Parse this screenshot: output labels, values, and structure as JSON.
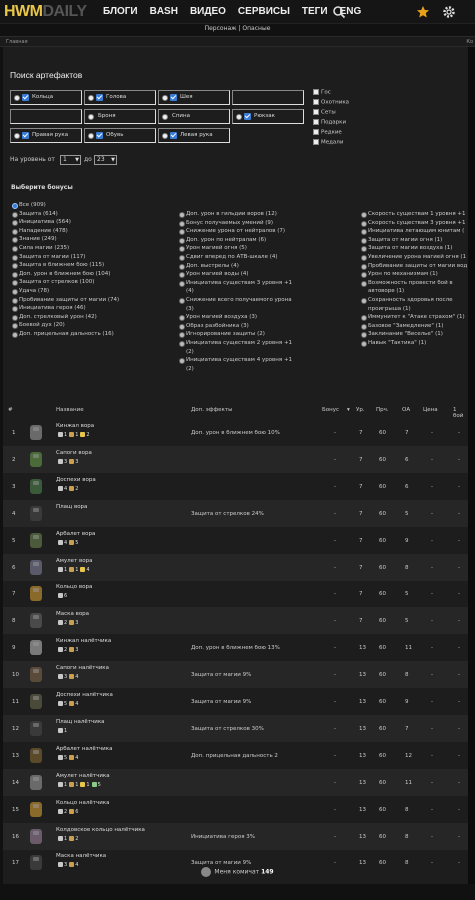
{
  "header": {
    "logo_main": "HWM",
    "logo_sub": "DAILY",
    "nav": [
      "БЛОГИ",
      "BASH",
      "ВИДЕО",
      "СЕРВИСЫ",
      "ТЕГИ",
      "ENG"
    ],
    "subtitle": "Персонаж | Опасные"
  },
  "breadcrumb": {
    "left": "Главная",
    "right": "Ко"
  },
  "search": {
    "title": "Поиск артефактов",
    "slots": [
      {
        "label": "Кольца",
        "checked": true
      },
      {
        "label": "Голова",
        "checked": true
      },
      {
        "label": "Шея",
        "checked": true
      },
      {
        "label": "",
        "checked": false
      },
      {
        "label": "",
        "checked": false
      },
      {
        "label": "Броня",
        "checked": false
      },
      {
        "label": "Спина",
        "checked": false
      },
      {
        "label": "Рюкзак",
        "checked": true
      },
      {
        "label": "Правая рука",
        "checked": true
      },
      {
        "label": "Обувь",
        "checked": true
      },
      {
        "label": "Левая рука",
        "checked": true
      }
    ],
    "checkboxes": [
      "Гос",
      "Охотника",
      "Сеты",
      "Подарки",
      "Редкие",
      "Медали"
    ],
    "level_label_from": "На уровень от",
    "level_from": "1",
    "level_label_to": "до",
    "level_to": "23"
  },
  "bonuses": {
    "title": "Выберите бонусы",
    "col1": [
      "Все (909)",
      "Защита (614)",
      "Инициатива (564)",
      "Нападение (478)",
      "Знание (249)",
      "Сила магии (235)",
      "Защита от магии (117)",
      "Защита в ближнем бою (115)",
      "Доп. урон в ближнем бою (104)",
      "Защита от стрелков (100)",
      "Удача (78)",
      "Пробивание защиты от магии (74)",
      "Инициатива героя (46)",
      "Доп. стрелковый урон (42)",
      "Боевой дух (20)",
      "Доп. прицельная дальность (16)"
    ],
    "col2": [
      "Доп. урон в гильдии воров (12)",
      "Бонус получаемых умений (9)",
      "Снижение урона от нейтралов (7)",
      "Доп. урон по нейтралам (6)",
      "Урон магией огня (5)",
      "Сдвиг вперед по АТВ-шкале (4)",
      "Доп. выстрелы (4)",
      "Урон магией воды (4)",
      "Инициатива существам 3 уровня +1 (4)",
      "Снижение всего получаемого урона (3)",
      "Урон магией воздуха (3)",
      "Образ разбойника (3)",
      "Игнорирование защиты (2)",
      "Инициатива существам 2 уровня +1 (2)",
      "Инициатива существам 4 уровня +1 (2)"
    ],
    "col3": [
      "Скорость существам 1 уровня +1",
      "Скорость существам 3 уровня +1",
      "Инициатива летающим юнитам (",
      "Защита от магии огня (1)",
      "Защита от магии воздуха (1)",
      "Увеличение урона магией огня (1",
      "Пробивание защиты от магии вод",
      "Урон по механизмам (1)",
      "Возможность провести бой в автоворе (1)",
      "Сохранность здоровья после проигрыша (1)",
      "Иммунитет к \"Атаке страхом\" (1)",
      "Базовое \"Замедление\" (1)",
      "Заклинание \"Веселье\" (1)",
      "Навык \"Тактика\" (1)"
    ]
  },
  "table": {
    "headers": [
      "#",
      "Название",
      "Доп. эффекты",
      "Бонус",
      "Ур.",
      "Прч.",
      "ОА",
      "Цена",
      "1 бой"
    ],
    "rows": [
      {
        "n": "1",
        "name": "Кинжал вора",
        "stats": [
          "1",
          "1",
          "2"
        ],
        "eff": "Доп. урон в ближнем бою 10%",
        "bonus": "-",
        "lvl": "7",
        "dur": "60",
        "oa": "7",
        "price": "-",
        "fight": "-"
      },
      {
        "n": "2",
        "name": "Сапоги вора",
        "stats": [
          "3",
          "3"
        ],
        "eff": "",
        "bonus": "-",
        "lvl": "7",
        "dur": "60",
        "oa": "6",
        "price": "-",
        "fight": "-"
      },
      {
        "n": "3",
        "name": "Доспехи вора",
        "stats": [
          "4",
          "2"
        ],
        "eff": "",
        "bonus": "-",
        "lvl": "7",
        "dur": "60",
        "oa": "6",
        "price": "-",
        "fight": "-"
      },
      {
        "n": "4",
        "name": "Плащ вора",
        "stats": [],
        "eff": "Защита от стрелков 24%",
        "bonus": "-",
        "lvl": "7",
        "dur": "60",
        "oa": "5",
        "price": "-",
        "fight": "-"
      },
      {
        "n": "5",
        "name": "Арбалет вора",
        "stats": [
          "4",
          "5"
        ],
        "eff": "",
        "bonus": "-",
        "lvl": "7",
        "dur": "60",
        "oa": "9",
        "price": "-",
        "fight": "-"
      },
      {
        "n": "6",
        "name": "Амулет вора",
        "stats": [
          "1",
          "1",
          "4"
        ],
        "eff": "",
        "bonus": "-",
        "lvl": "7",
        "dur": "60",
        "oa": "8",
        "price": "-",
        "fight": "-"
      },
      {
        "n": "7",
        "name": "Кольцо вора",
        "stats": [
          "6"
        ],
        "eff": "",
        "bonus": "-",
        "lvl": "7",
        "dur": "60",
        "oa": "5",
        "price": "-",
        "fight": "-"
      },
      {
        "n": "8",
        "name": "Маска вора",
        "stats": [
          "2",
          "3"
        ],
        "eff": "",
        "bonus": "-",
        "lvl": "7",
        "dur": "60",
        "oa": "5",
        "price": "-",
        "fight": "-"
      },
      {
        "n": "9",
        "name": "Кинжал налётчика",
        "stats": [
          "2",
          "3"
        ],
        "eff": "Доп. урон в ближнем бою 13%",
        "bonus": "-",
        "lvl": "13",
        "dur": "60",
        "oa": "11",
        "price": "-",
        "fight": "-"
      },
      {
        "n": "10",
        "name": "Сапоги налётчика",
        "stats": [
          "3",
          "4"
        ],
        "eff": "Защита от магии 9%",
        "bonus": "-",
        "lvl": "13",
        "dur": "60",
        "oa": "8",
        "price": "-",
        "fight": "-"
      },
      {
        "n": "11",
        "name": "Доспехи налётчика",
        "stats": [
          "5",
          "4"
        ],
        "eff": "Защита от магии 9%",
        "bonus": "-",
        "lvl": "13",
        "dur": "60",
        "oa": "9",
        "price": "-",
        "fight": "-"
      },
      {
        "n": "12",
        "name": "Плащ налётчика",
        "stats": [
          "1"
        ],
        "eff": "Защита от стрелков 30%",
        "bonus": "-",
        "lvl": "13",
        "dur": "60",
        "oa": "7",
        "price": "-",
        "fight": "-"
      },
      {
        "n": "13",
        "name": "Арбалет налётчика",
        "stats": [
          "5",
          "4"
        ],
        "eff": "Доп. прицельная дальность 2",
        "bonus": "-",
        "lvl": "13",
        "dur": "60",
        "oa": "12",
        "price": "-",
        "fight": "-"
      },
      {
        "n": "14",
        "name": "Амулет налётчика",
        "stats": [
          "1",
          "1",
          "1",
          "5"
        ],
        "eff": "",
        "bonus": "-",
        "lvl": "13",
        "dur": "60",
        "oa": "11",
        "price": "-",
        "fight": "-"
      },
      {
        "n": "15",
        "name": "Кольцо налётчика",
        "stats": [
          "2",
          "6"
        ],
        "eff": "",
        "bonus": "-",
        "lvl": "13",
        "dur": "60",
        "oa": "8",
        "price": "-",
        "fight": "-"
      },
      {
        "n": "16",
        "name": "Колдовское кольцо налётчика",
        "stats": [
          "1",
          "2"
        ],
        "eff": "Инициатива героя 3%",
        "bonus": "-",
        "lvl": "13",
        "dur": "60",
        "oa": "8",
        "price": "-",
        "fight": "-"
      },
      {
        "n": "17",
        "name": "Маска налётчика",
        "stats": [
          "3",
          "4"
        ],
        "eff": "Защита от магии 9%",
        "bonus": "-",
        "lvl": "13",
        "dur": "60",
        "oa": "8",
        "price": "-",
        "fight": "-"
      }
    ]
  },
  "footer": {
    "text": "Меня комичат",
    "count": "149"
  },
  "colors": {
    "accent": "#e8c64a",
    "check": "#3a7bd5",
    "star": "#e8a21a"
  }
}
